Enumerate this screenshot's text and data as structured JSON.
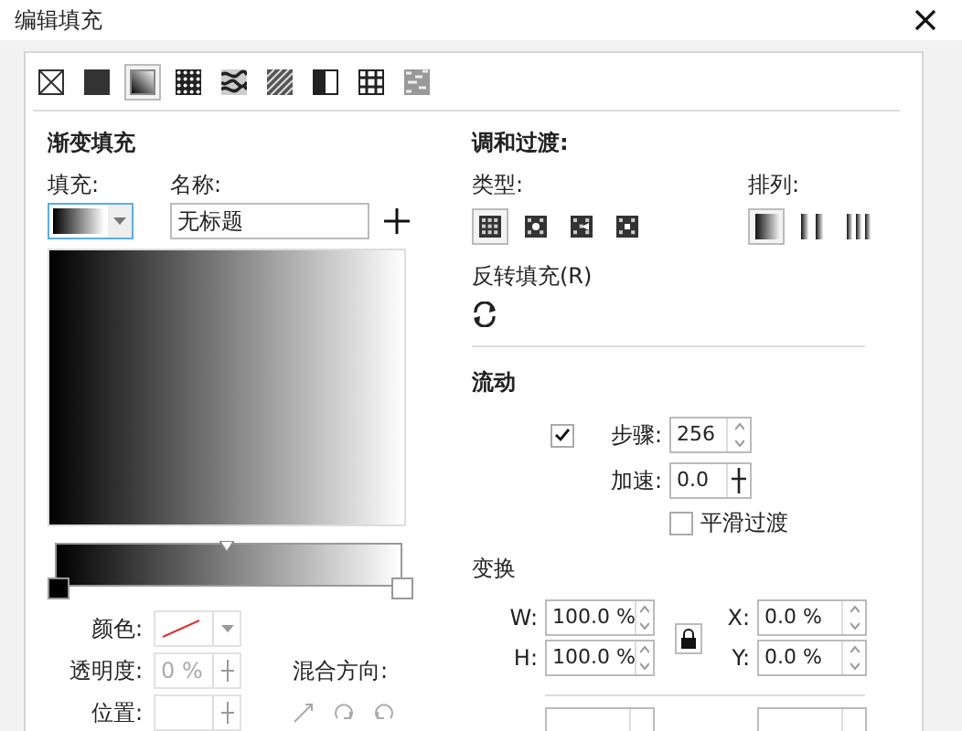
{
  "window": {
    "title": "编辑填充"
  },
  "fill_types": [
    {
      "kind": "none",
      "selected": false
    },
    {
      "kind": "uniform",
      "selected": false
    },
    {
      "kind": "fountain",
      "selected": true
    },
    {
      "kind": "vector",
      "selected": false
    },
    {
      "kind": "bitmap",
      "selected": false
    },
    {
      "kind": "twocolor",
      "selected": false
    },
    {
      "kind": "halftone",
      "selected": false
    },
    {
      "kind": "postscript",
      "selected": false
    },
    {
      "kind": "texture",
      "selected": false
    }
  ],
  "gradient": {
    "heading": "渐变填充",
    "fill_label": "填充:",
    "name_label": "名称:",
    "name_value": "无标题"
  },
  "stops": [
    {
      "color": "#000000"
    },
    {
      "color": "#ffffff"
    }
  ],
  "stop_props": {
    "color_label": "颜色:",
    "transparency_label": "透明度:",
    "transparency_value": "0 %",
    "position_label": "位置:",
    "disabled": true,
    "blend_direction_label": "混合方向:"
  },
  "blend": {
    "heading": "调和过渡:",
    "type_label": "类型:",
    "arrange_label": "排列:",
    "reverse_label": "反转填充(R)",
    "types": [
      {
        "kind": "linear",
        "selected": true
      },
      {
        "kind": "elliptical",
        "selected": false
      },
      {
        "kind": "conical",
        "selected": false
      },
      {
        "kind": "rectangular",
        "selected": false
      }
    ],
    "arrangements": [
      {
        "kind": "default",
        "selected": true
      },
      {
        "kind": "mirror",
        "selected": false
      },
      {
        "kind": "repeat",
        "selected": false
      }
    ]
  },
  "flow": {
    "heading": "流动",
    "steps_checked": true,
    "steps_label": "步骤:",
    "steps_value": "256",
    "accel_label": "加速:",
    "accel_value": "0.0",
    "smooth_checked": false,
    "smooth_label": "平滑过渡"
  },
  "transform": {
    "heading": "变换",
    "fields": [
      {
        "label": "W:",
        "value": "100.0 %"
      },
      {
        "label": "X:",
        "value": "0.0 %"
      },
      {
        "label": "H:",
        "value": "100.0 %"
      },
      {
        "label": "Y:",
        "value": "0.0 %"
      }
    ]
  }
}
